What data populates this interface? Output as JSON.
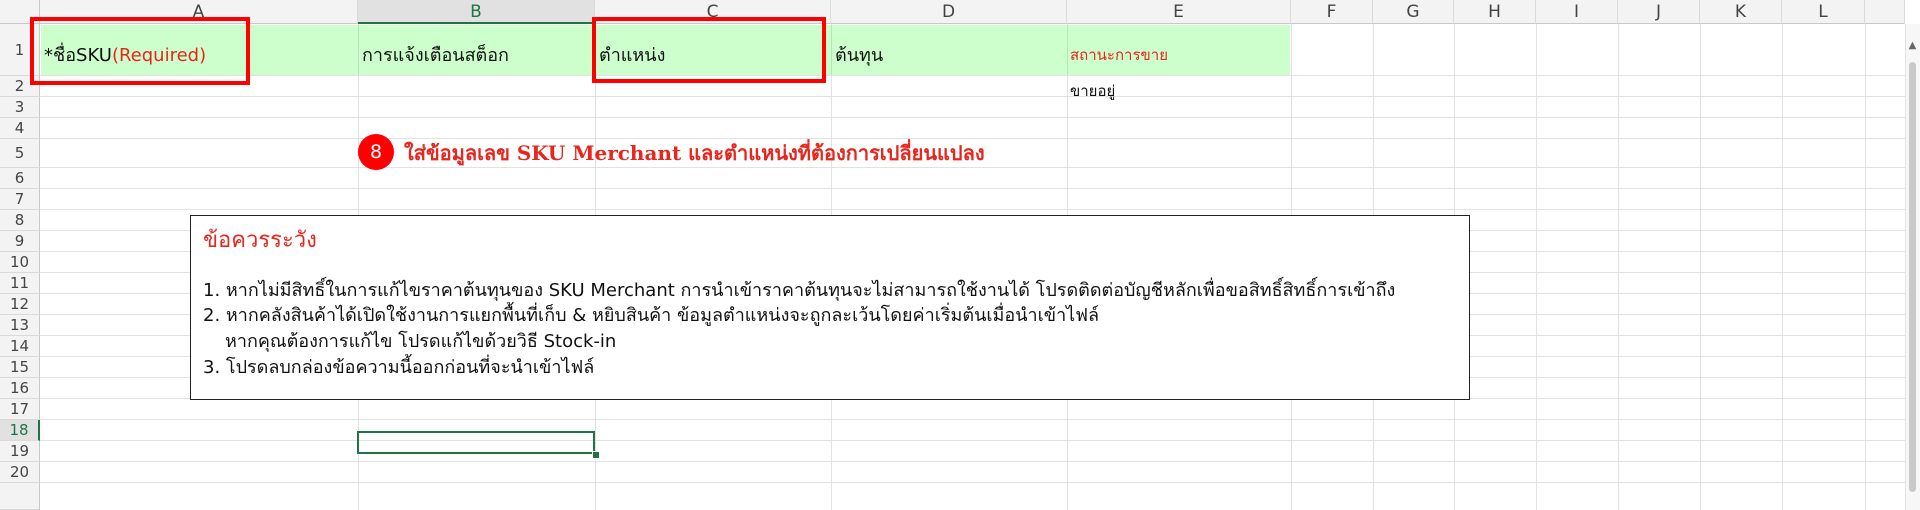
{
  "columns": [
    "A",
    "B",
    "C",
    "D",
    "E",
    "F",
    "G",
    "H",
    "I",
    "J",
    "K",
    "L"
  ],
  "rows": [
    "1",
    "2",
    "3",
    "4",
    "5",
    "6",
    "7",
    "8",
    "9",
    "10",
    "11",
    "12",
    "13",
    "14",
    "15",
    "16",
    "17",
    "18",
    "19",
    "20"
  ],
  "active_column": "B",
  "active_row": "18",
  "cells": {
    "a1_prefix": "*ชื่อSKU",
    "a1_required": "(Required)",
    "b1": "การแจ้งเตือนสต็อก",
    "c1": "ตำแหน่ง",
    "d1": "ต้นทุน",
    "e1": "สถานะการขาย",
    "e2": "ขายอยู่"
  },
  "annotation": {
    "badge": "8",
    "text": "ใส่ข้อมูลเลข SKU Merchant และตำแหน่งที่ต้องการเปลี่ยนแปลง"
  },
  "note": {
    "title": "ข้อควรระวัง",
    "line1": "1. หากไม่มีสิทธิ์ในการแก้ไขราคาต้นทุนของ SKU Merchant การนำเข้าราคาต้นทุนจะไม่สามารถใช้งานได้ โปรดติดต่อบัญชีหลักเพื่อขอสิทธิ์สิทธิ์การเข้าถึง",
    "line2": "2. หากคลังสินค้าได้เปิดใช้งานการแยกพื้นที่เก็บ & หยิบสินค้า ข้อมูลตำแหน่งจะถูกละเว้นโดยค่าเริ่มต้นเมื่อนำเข้าไฟล์",
    "line2b": "หากคุณต้องการแก้ไข โปรดแก้ไขด้วยวิธี Stock-in",
    "line3": "3. โปรดลบกล่องข้อความนี้ออกก่อนที่จะนำเข้าไฟล์"
  },
  "colors": {
    "header_fill": "#ccffcc",
    "highlight_red": "#ff0000",
    "selection_green": "#217346"
  },
  "icons": {
    "scroll_up": "triangle-up-icon"
  }
}
